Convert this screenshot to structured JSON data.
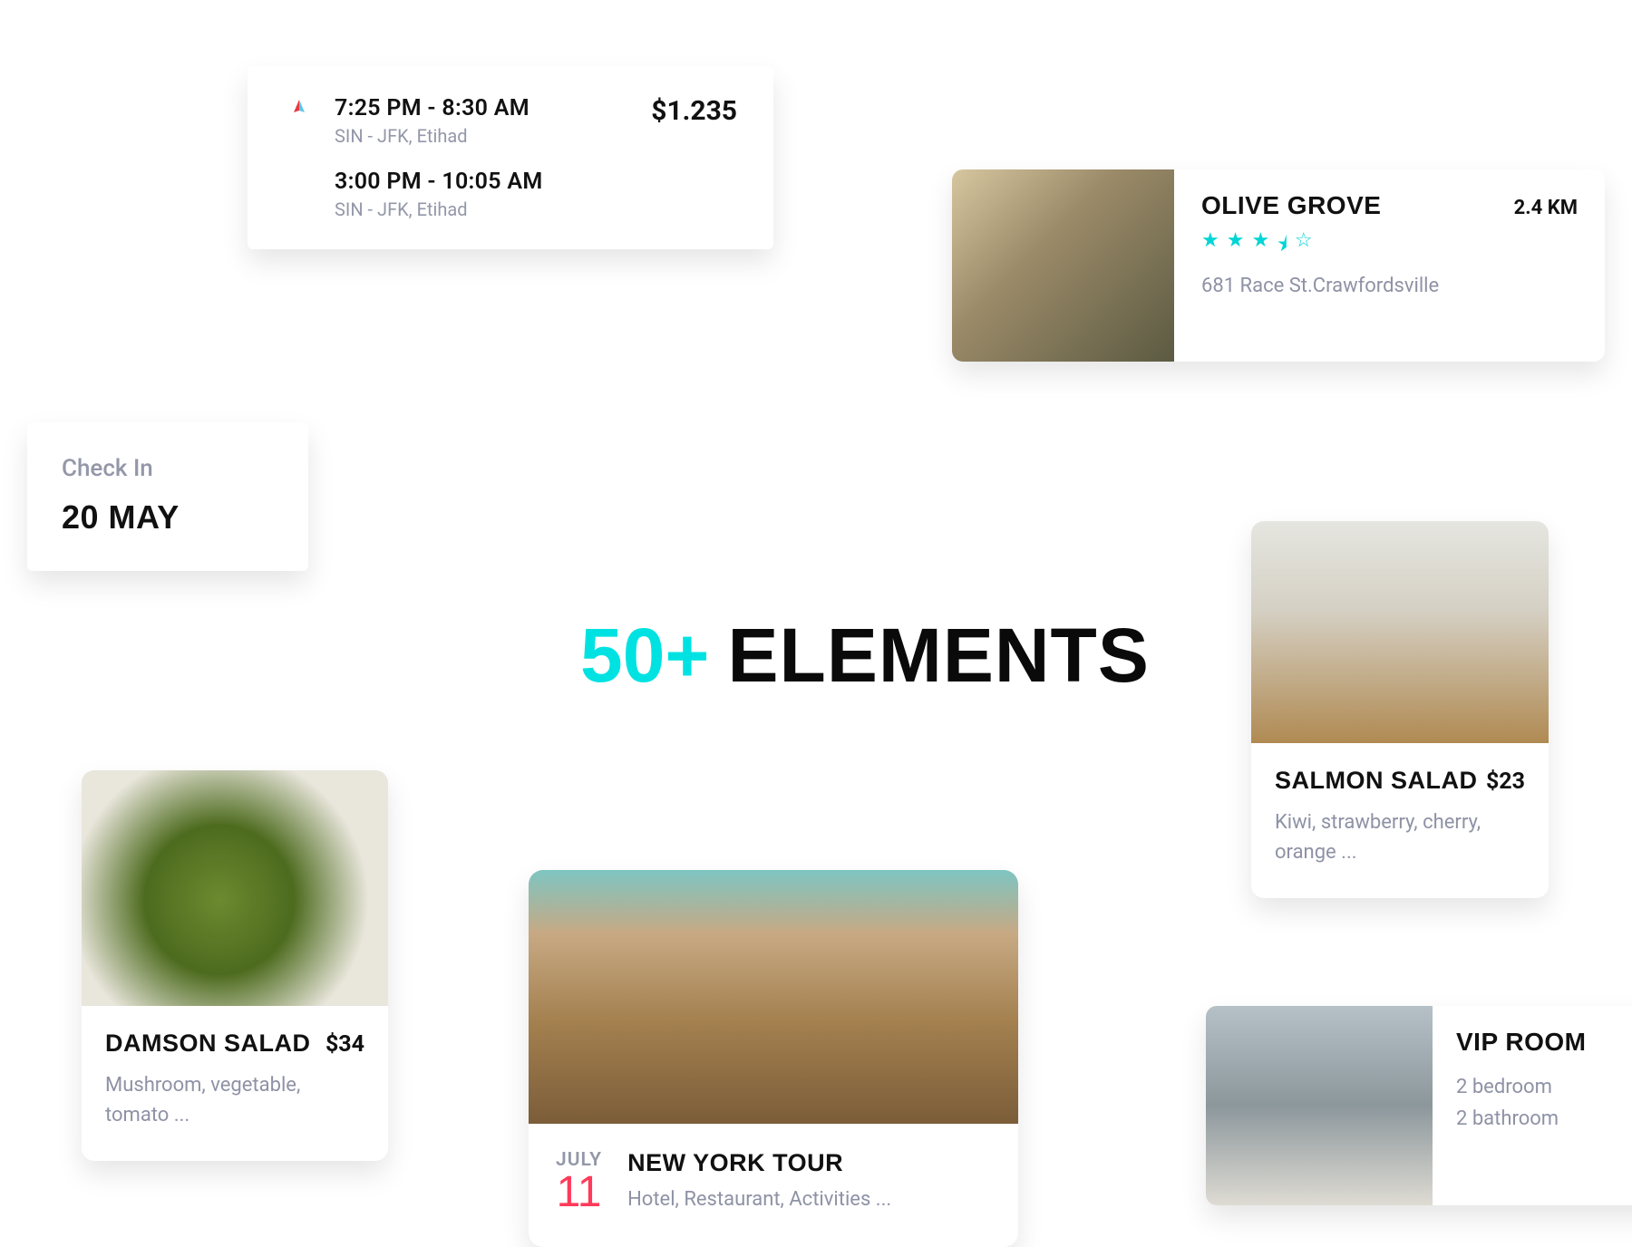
{
  "flight": {
    "price": "$1.235",
    "segments": [
      {
        "time": "7:25 PM - 8:30 AM",
        "route": "SIN - JFK, Etihad"
      },
      {
        "time": "3:00 PM - 10:05 AM",
        "route": "SIN - JFK, Etihad"
      }
    ]
  },
  "restaurant": {
    "name": "OLIVE GROVE",
    "distance": "2.4 KM",
    "rating": 3.5,
    "address": "681 Race St.Crawfordsville"
  },
  "checkin": {
    "label": "Check In",
    "date": "20 MAY"
  },
  "headline": {
    "accent": "50+",
    "rest": "ELEMENTS"
  },
  "damson": {
    "name": "DAMSON SALAD",
    "price": "$34",
    "desc": "Mushroom, vegetable, tomato ..."
  },
  "salmon": {
    "name": "SALMON SALAD",
    "price": "$23",
    "desc": "Kiwi, strawberry, cherry, orange ..."
  },
  "tour": {
    "month": "JULY",
    "day": "11",
    "name": "NEW YORK TOUR",
    "desc": "Hotel, Restaurant, Activities ..."
  },
  "vip": {
    "name": "VIP ROOM",
    "desc": "2 bedroom\n2 bathroom"
  }
}
